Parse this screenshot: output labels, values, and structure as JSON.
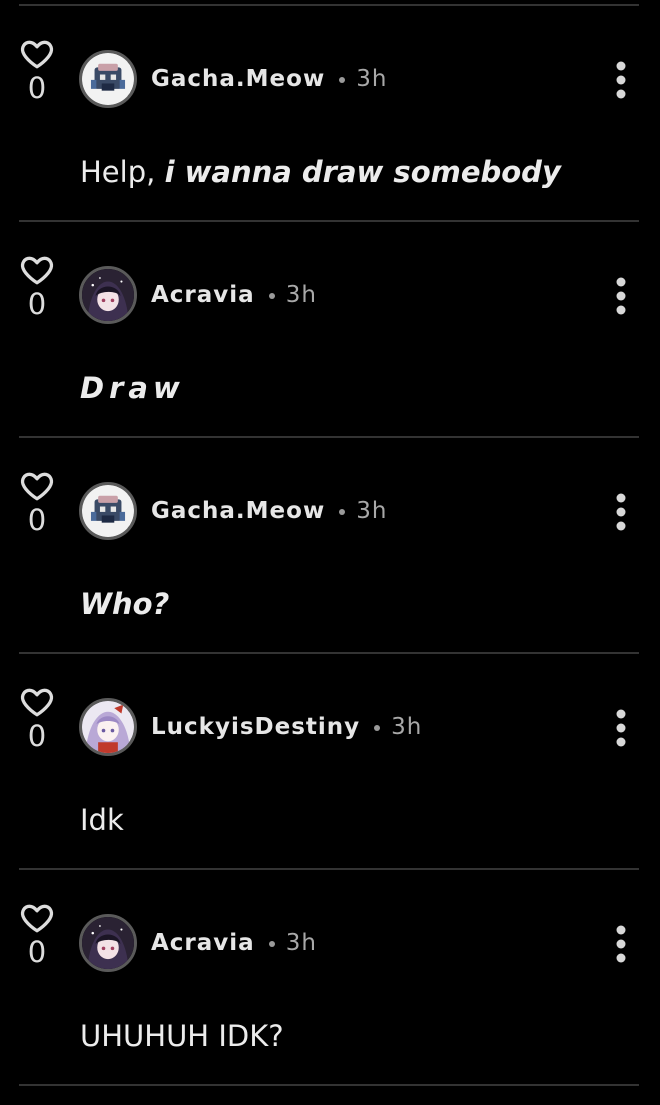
{
  "comments": [
    {
      "likes": "0",
      "username": "Gacha.Meow",
      "time": "3h",
      "text_plain": "Help, ",
      "text_emphasis": "i wanna draw somebody",
      "avatar": "avatar-gacha-meow"
    },
    {
      "likes": "0",
      "username": "Acravia",
      "time": "3h",
      "text_plain": "",
      "text_emphasis": "Draw",
      "avatar": "avatar-acravia"
    },
    {
      "likes": "0",
      "username": "Gacha.Meow",
      "time": "3h",
      "text_plain": "",
      "text_emphasis": "Who?",
      "avatar": "avatar-gacha-meow"
    },
    {
      "likes": "0",
      "username": "LuckyisDestiny",
      "time": "3h",
      "text_plain": "Idk",
      "text_emphasis": "",
      "avatar": "avatar-luckyisdestiny"
    },
    {
      "likes": "0",
      "username": "Acravia",
      "time": "3h",
      "text_plain": "UHUHUH IDK?",
      "text_emphasis": "",
      "avatar": "avatar-acravia"
    }
  ],
  "icons": {
    "like": "heart-outline-icon",
    "menu": "more-vertical-icon"
  },
  "colors": {
    "background": "#000000",
    "divider": "#333333",
    "text": "#ececec",
    "muted": "#a8a8a8"
  }
}
